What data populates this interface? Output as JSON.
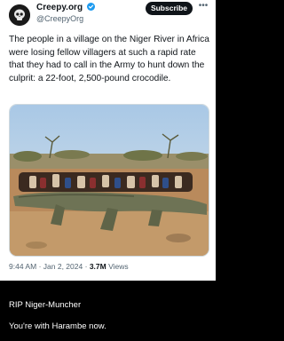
{
  "post": {
    "author_name": "Creepy.org",
    "author_handle": "@CreepyOrg",
    "subscribe_label": "Subscribe",
    "more_label": "•••",
    "text": "The people in a village on the Niger River in Africa were losing fellow villagers at such a rapid rate that they had to call in the Army to hunt down the culprit: a 22-foot, 2,500-pound crocodile.",
    "time": "9:44 AM",
    "separator": "·",
    "date": "Jan 2, 2024",
    "views_count": "3.7M",
    "views_label": "Views",
    "verified_color": "#1d9bf0",
    "accent_color": "#0f1419"
  },
  "comments": [
    "RIP Niger-Muncher",
    "You're with Harambe now."
  ]
}
